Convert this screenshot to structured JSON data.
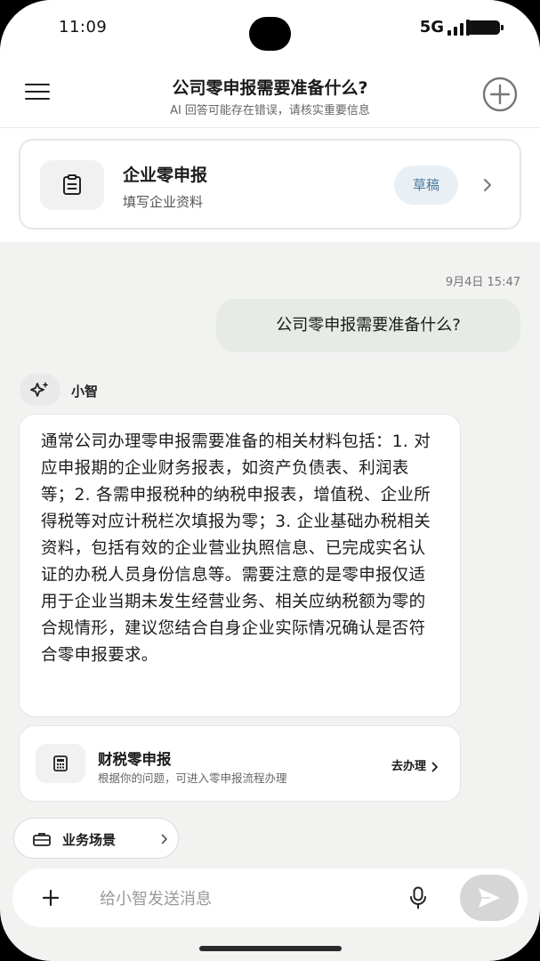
{
  "status_bar": {
    "time": "11:09",
    "network": "5G"
  },
  "header": {
    "title": "公司零申报需要准备什么?",
    "subtitle": "AI 回答可能存在错误，请核实重要信息"
  },
  "draft_card": {
    "title": "企业零申报",
    "subtitle": "填写企业资料",
    "badge": "草稿"
  },
  "chat": {
    "timestamp": "9月4日 15:47",
    "user_message": "公司零申报需要准备什么?",
    "bot_name": "小智",
    "bot_answer": "通常公司办理零申报需要准备的相关材料包括：1. 对应申报期的企业财务报表，如资产负债表、利润表等；2. 各需申报税种的纳税申报表，增值税、企业所得税等对应计税栏次填报为零；3. 企业基础办税相关资料，包括有效的企业营业执照信息、已完成实名认证的办税人员身份信息等。需要注意的是零申报仅适用于企业当期未发生经营业务、相关应纳税额为零的合规情形，建议您结合自身企业实际情况确认是否符合零申报要求。",
    "service_card": {
      "title": "财税零申报",
      "description": "根据你的问题，可进入零申报流程办理",
      "action": "去办理"
    }
  },
  "scene_chip": {
    "label": "业务场景"
  },
  "input_bar": {
    "placeholder": "给小智发送消息"
  },
  "colors": {
    "background": "#f2f2f1",
    "user_bubble": "#e6ebe6",
    "badge_bg": "#e8eff5",
    "badge_text": "#4d7a9c",
    "send_disabled": "#d6d6d6"
  }
}
